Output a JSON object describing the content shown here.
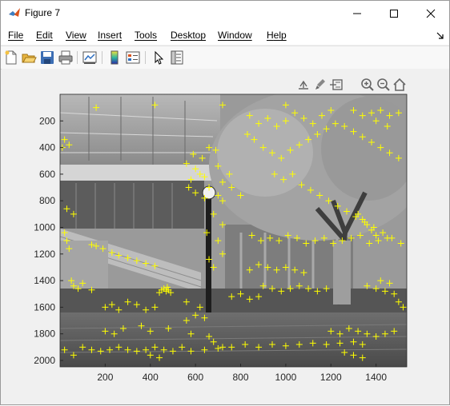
{
  "window": {
    "title": "Figure 7"
  },
  "menu": {
    "items": [
      "File",
      "Edit",
      "View",
      "Insert",
      "Tools",
      "Desktop",
      "Window",
      "Help"
    ]
  },
  "toolbar": {
    "icons": [
      "new-figure-icon",
      "open-file-icon",
      "save-icon",
      "print-icon",
      "link-plot-icon",
      "colorbar-icon",
      "legend-icon",
      "pointer-icon",
      "property-inspector-icon"
    ]
  },
  "axes_toolbar": {
    "icons": [
      "export-icon",
      "brush-icon",
      "datatip-icon",
      "zoom-in-icon",
      "zoom-out-icon",
      "home-icon"
    ]
  },
  "colors": {
    "marker": "#ffff00",
    "axes_bg": "#ffffff",
    "figure_bg": "#f0f0f0"
  },
  "chart_data": {
    "type": "scatter",
    "title": "",
    "xlabel": "",
    "ylabel": "",
    "xlim": [
      0,
      1536
    ],
    "ylim": [
      2048,
      0
    ],
    "y_direction": "reverse",
    "x_ticks": [
      "200",
      "400",
      "600",
      "800",
      "1000",
      "1200",
      "1400"
    ],
    "x_tick_values": [
      200,
      400,
      600,
      800,
      1000,
      1200,
      1400
    ],
    "y_ticks": [
      "200",
      "400",
      "600",
      "800",
      "1000",
      "1200",
      "1400",
      "1600",
      "1800",
      "2000"
    ],
    "y_tick_values": [
      200,
      400,
      600,
      800,
      1000,
      1200,
      1400,
      1600,
      1800,
      2000
    ],
    "background_image": "grayscale photo of a building with a tree and lamp post",
    "marker": "+",
    "series": [
      {
        "points": [
          [
            190,
            1160
          ],
          [
            230,
            1190
          ],
          [
            260,
            1210
          ],
          [
            300,
            1230
          ],
          [
            340,
            1250
          ],
          [
            380,
            1270
          ],
          [
            420,
            1290
          ],
          [
            160,
            1140
          ],
          [
            140,
            1130
          ],
          [
            460,
            1460
          ],
          [
            470,
            1480
          ],
          [
            450,
            1470
          ],
          [
            480,
            1470
          ],
          [
            440,
            1490
          ],
          [
            490,
            1490
          ],
          [
            475,
            1450
          ],
          [
            600,
            560
          ],
          [
            620,
            600
          ],
          [
            640,
            620
          ],
          [
            580,
            640
          ],
          [
            660,
            700
          ],
          [
            700,
            760
          ],
          [
            720,
            800
          ],
          [
            560,
            520
          ],
          [
            590,
            450
          ],
          [
            630,
            480
          ],
          [
            570,
            700
          ],
          [
            600,
            740
          ],
          [
            640,
            780
          ],
          [
            700,
            540
          ],
          [
            750,
            600
          ],
          [
            720,
            660
          ],
          [
            760,
            700
          ],
          [
            800,
            760
          ],
          [
            690,
            420
          ],
          [
            660,
            400
          ],
          [
            830,
            300
          ],
          [
            860,
            340
          ],
          [
            900,
            400
          ],
          [
            940,
            440
          ],
          [
            980,
            480
          ],
          [
            1020,
            420
          ],
          [
            1060,
            380
          ],
          [
            1100,
            340
          ],
          [
            1140,
            300
          ],
          [
            1180,
            260
          ],
          [
            1220,
            220
          ],
          [
            1260,
            240
          ],
          [
            1300,
            280
          ],
          [
            1340,
            320
          ],
          [
            1380,
            360
          ],
          [
            1420,
            400
          ],
          [
            1460,
            440
          ],
          [
            1500,
            480
          ],
          [
            1040,
            140
          ],
          [
            1080,
            180
          ],
          [
            1120,
            220
          ],
          [
            1160,
            160
          ],
          [
            1000,
            200
          ],
          [
            960,
            240
          ],
          [
            920,
            180
          ],
          [
            880,
            220
          ],
          [
            1300,
            120
          ],
          [
            1340,
            160
          ],
          [
            1380,
            140
          ],
          [
            1420,
            120
          ],
          [
            1460,
            160
          ],
          [
            1500,
            140
          ],
          [
            1400,
            200
          ],
          [
            1450,
            240
          ],
          [
            950,
            600
          ],
          [
            990,
            640
          ],
          [
            1030,
            600
          ],
          [
            1070,
            680
          ],
          [
            1110,
            720
          ],
          [
            1150,
            760
          ],
          [
            1190,
            800
          ],
          [
            1230,
            840
          ],
          [
            1270,
            880
          ],
          [
            1310,
            920
          ],
          [
            1350,
            960
          ],
          [
            1390,
            1000
          ],
          [
            1430,
            1040
          ],
          [
            1470,
            1080
          ],
          [
            1510,
            1120
          ],
          [
            850,
            1060
          ],
          [
            890,
            1100
          ],
          [
            930,
            1080
          ],
          [
            970,
            1100
          ],
          [
            1010,
            1060
          ],
          [
            1050,
            1080
          ],
          [
            1090,
            1120
          ],
          [
            1130,
            1100
          ],
          [
            1170,
            1080
          ],
          [
            1210,
            1120
          ],
          [
            1250,
            1100
          ],
          [
            1290,
            1080
          ],
          [
            1330,
            1060
          ],
          [
            1370,
            1120
          ],
          [
            1410,
            1100
          ],
          [
            1450,
            1080
          ],
          [
            1320,
            900
          ],
          [
            1340,
            940
          ],
          [
            1360,
            980
          ],
          [
            1380,
            1020
          ],
          [
            1400,
            1060
          ],
          [
            1360,
            1440
          ],
          [
            1400,
            1460
          ],
          [
            1440,
            1480
          ],
          [
            1480,
            1500
          ],
          [
            1460,
            1420
          ],
          [
            1420,
            1400
          ],
          [
            1500,
            1560
          ],
          [
            1520,
            1600
          ],
          [
            900,
            1440
          ],
          [
            940,
            1460
          ],
          [
            980,
            1480
          ],
          [
            1020,
            1460
          ],
          [
            1060,
            1440
          ],
          [
            1100,
            1460
          ],
          [
            1140,
            1480
          ],
          [
            1180,
            1460
          ],
          [
            20,
            1040
          ],
          [
            30,
            1100
          ],
          [
            40,
            1160
          ],
          [
            50,
            1400
          ],
          [
            60,
            1440
          ],
          [
            80,
            1460
          ],
          [
            100,
            1420
          ],
          [
            140,
            1470
          ],
          [
            100,
            1900
          ],
          [
            140,
            1920
          ],
          [
            180,
            1930
          ],
          [
            220,
            1920
          ],
          [
            260,
            1900
          ],
          [
            300,
            1920
          ],
          [
            340,
            1930
          ],
          [
            380,
            1920
          ],
          [
            420,
            1900
          ],
          [
            460,
            1920
          ],
          [
            500,
            1930
          ],
          [
            540,
            1900
          ],
          [
            580,
            1930
          ],
          [
            640,
            1920
          ],
          [
            700,
            1910
          ],
          [
            760,
            1900
          ],
          [
            820,
            1880
          ],
          [
            880,
            1900
          ],
          [
            940,
            1880
          ],
          [
            1000,
            1890
          ],
          [
            1060,
            1880
          ],
          [
            1120,
            1870
          ],
          [
            1180,
            1880
          ],
          [
            1240,
            1870
          ],
          [
            1300,
            1860
          ],
          [
            1340,
            1880
          ],
          [
            200,
            1780
          ],
          [
            240,
            1800
          ],
          [
            280,
            1760
          ],
          [
            360,
            1740
          ],
          [
            400,
            1780
          ],
          [
            480,
            1760
          ],
          [
            560,
            1700
          ],
          [
            600,
            1660
          ],
          [
            640,
            1680
          ],
          [
            660,
            1820
          ],
          [
            580,
            1800
          ],
          [
            680,
            1860
          ],
          [
            720,
            1900
          ],
          [
            200,
            1600
          ],
          [
            230,
            1580
          ],
          [
            260,
            1620
          ],
          [
            300,
            1560
          ],
          [
            340,
            1580
          ],
          [
            380,
            1620
          ],
          [
            420,
            1600
          ],
          [
            1200,
            1780
          ],
          [
            1240,
            1800
          ],
          [
            1280,
            1760
          ],
          [
            1320,
            1780
          ],
          [
            1360,
            1800
          ],
          [
            1400,
            1820
          ],
          [
            1440,
            1800
          ],
          [
            1480,
            1780
          ],
          [
            160,
            100
          ],
          [
            720,
            80
          ],
          [
            840,
            160
          ],
          [
            420,
            80
          ],
          [
            1000,
            80
          ],
          [
            1200,
            120
          ],
          [
            20,
            340
          ],
          [
            40,
            380
          ],
          [
            10,
            400
          ],
          [
            60,
            900
          ],
          [
            30,
            860
          ],
          [
            700,
            1100
          ],
          [
            720,
            1200
          ],
          [
            680,
            1300
          ],
          [
            660,
            1240
          ],
          [
            650,
            1040
          ],
          [
            720,
            980
          ],
          [
            680,
            900
          ],
          [
            1000,
            1300
          ],
          [
            1040,
            1320
          ],
          [
            1080,
            1340
          ],
          [
            960,
            1320
          ],
          [
            920,
            1300
          ],
          [
            880,
            1280
          ],
          [
            840,
            1320
          ],
          [
            760,
            1520
          ],
          [
            800,
            1500
          ],
          [
            840,
            1540
          ],
          [
            880,
            1520
          ],
          [
            620,
            1600
          ],
          [
            560,
            1560
          ],
          [
            1300,
            1960
          ],
          [
            1340,
            1980
          ],
          [
            1260,
            1940
          ],
          [
            400,
            1960
          ],
          [
            440,
            1980
          ],
          [
            20,
            1920
          ],
          [
            60,
            1960
          ]
        ]
      }
    ]
  }
}
